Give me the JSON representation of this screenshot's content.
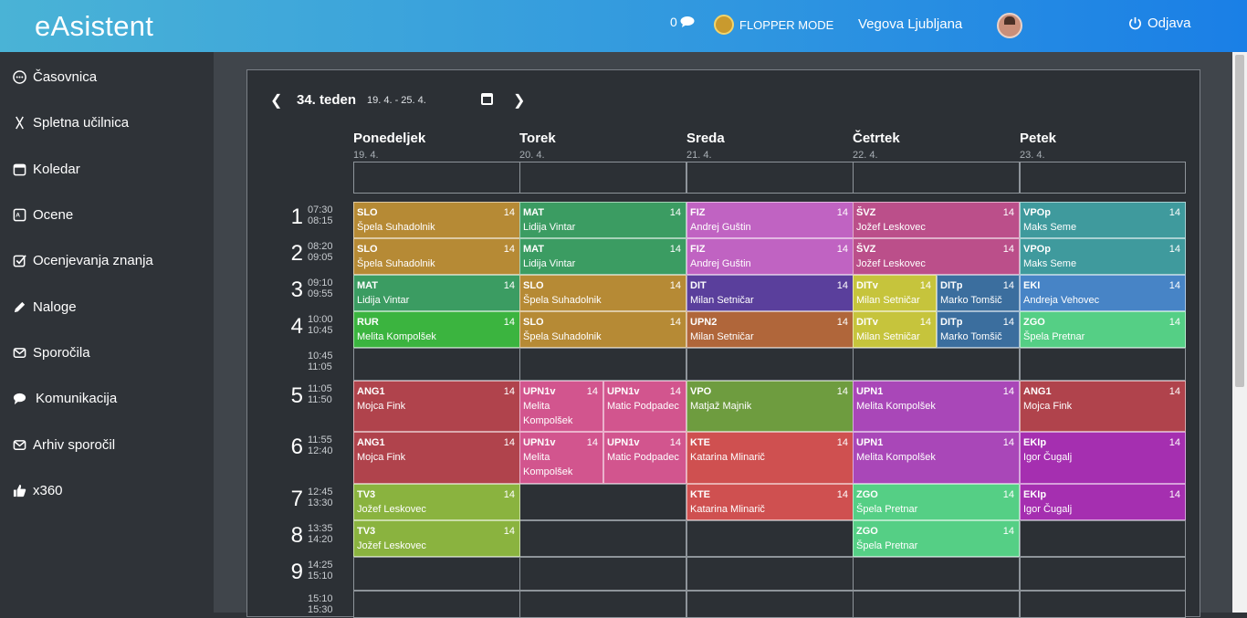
{
  "topbar": {
    "brand": "eAsistent",
    "message_count": "0",
    "flopper": "FLOPPER MODE",
    "school": "Vegova Ljubljana",
    "logout": "Odjava"
  },
  "sidebar": [
    {
      "label": "Časovnica",
      "icon": "timeline-icon"
    },
    {
      "label": "Spletna učilnica",
      "icon": "classroom-icon"
    },
    {
      "label": "Koledar",
      "icon": "calendar-icon"
    },
    {
      "label": "Ocene",
      "icon": "grades-icon"
    },
    {
      "label": "Ocenjevanja znanja",
      "icon": "check-icon"
    },
    {
      "label": "Naloge",
      "icon": "pencil-icon"
    },
    {
      "label": "Sporočila",
      "icon": "envelope-icon"
    },
    {
      "label": "Komunikacija",
      "icon": "chat-icon"
    },
    {
      "label": "Arhiv sporočil",
      "icon": "archive-envelope-icon"
    },
    {
      "label": "x360",
      "icon": "thumbs-up-icon"
    }
  ],
  "week": {
    "title": "34. teden",
    "range": "19. 4. - 25. 4."
  },
  "days": [
    {
      "name": "Ponedeljek",
      "date": "19. 4."
    },
    {
      "name": "Torek",
      "date": "20. 4."
    },
    {
      "name": "Sreda",
      "date": "21. 4."
    },
    {
      "name": "Četrtek",
      "date": "22. 4."
    },
    {
      "name": "Petek",
      "date": "23. 4."
    }
  ],
  "hours": [
    {
      "num": "1",
      "start": "07:30",
      "end": "08:15"
    },
    {
      "num": "2",
      "start": "08:20",
      "end": "09:05"
    },
    {
      "num": "3",
      "start": "09:10",
      "end": "09:55"
    },
    {
      "num": "4",
      "start": "10:00",
      "end": "10:45"
    },
    {
      "num": "",
      "start": "10:45",
      "end": "11:05"
    },
    {
      "num": "5",
      "start": "11:05",
      "end": "11:50"
    },
    {
      "num": "6",
      "start": "11:55",
      "end": "12:40"
    },
    {
      "num": "7",
      "start": "12:45",
      "end": "13:30"
    },
    {
      "num": "8",
      "start": "13:35",
      "end": "14:20"
    },
    {
      "num": "9",
      "start": "14:25",
      "end": "15:10"
    },
    {
      "num": "",
      "start": "15:10",
      "end": "15:30"
    }
  ],
  "lessons": [
    {
      "day": 0,
      "row": 0,
      "half": 0,
      "subj": "SLO",
      "teacher": "Špela Suhadolnik",
      "room": "14",
      "color": "#b68a35"
    },
    {
      "day": 1,
      "row": 0,
      "half": 0,
      "subj": "MAT",
      "teacher": "Lidija Vintar",
      "room": "14",
      "color": "#3b9c62"
    },
    {
      "day": 2,
      "row": 0,
      "half": 0,
      "subj": "FIZ",
      "teacher": "Andrej Guštin",
      "room": "14",
      "color": "#c063c2"
    },
    {
      "day": 3,
      "row": 0,
      "half": 0,
      "subj": "ŠVZ",
      "teacher": "Jožef Leskovec",
      "room": "14",
      "color": "#bb4f8a"
    },
    {
      "day": 4,
      "row": 0,
      "half": 0,
      "subj": "VPOp",
      "teacher": "Maks Seme",
      "room": "14",
      "color": "#3f9a9d"
    },
    {
      "day": 0,
      "row": 1,
      "half": 0,
      "subj": "SLO",
      "teacher": "Špela Suhadolnik",
      "room": "14",
      "color": "#b68a35"
    },
    {
      "day": 1,
      "row": 1,
      "half": 0,
      "subj": "MAT",
      "teacher": "Lidija Vintar",
      "room": "14",
      "color": "#3b9c62"
    },
    {
      "day": 2,
      "row": 1,
      "half": 0,
      "subj": "FIZ",
      "teacher": "Andrej Guštin",
      "room": "14",
      "color": "#c063c2"
    },
    {
      "day": 3,
      "row": 1,
      "half": 0,
      "subj": "ŠVZ",
      "teacher": "Jožef Leskovec",
      "room": "14",
      "color": "#bb4f8a"
    },
    {
      "day": 4,
      "row": 1,
      "half": 0,
      "subj": "VPOp",
      "teacher": "Maks Seme",
      "room": "14",
      "color": "#3f9a9d"
    },
    {
      "day": 0,
      "row": 2,
      "half": 0,
      "subj": "MAT",
      "teacher": "Lidija Vintar",
      "room": "14",
      "color": "#3b9c62"
    },
    {
      "day": 1,
      "row": 2,
      "half": 0,
      "subj": "SLO",
      "teacher": "Špela Suhadolnik",
      "room": "14",
      "color": "#b68a35"
    },
    {
      "day": 2,
      "row": 2,
      "half": 0,
      "subj": "DIT",
      "teacher": "Milan Setničar",
      "room": "14",
      "color": "#5a3f9c"
    },
    {
      "day": 3,
      "row": 2,
      "half": 1,
      "subj": "DITv",
      "teacher": "Milan Setničar",
      "room": "14",
      "color": "#c6c43c"
    },
    {
      "day": 3,
      "row": 2,
      "half": 2,
      "subj": "DITp",
      "teacher": "Marko Tomšič",
      "room": "14",
      "color": "#3b6e9e"
    },
    {
      "day": 4,
      "row": 2,
      "half": 0,
      "subj": "EKI",
      "teacher": "Andreja Vehovec",
      "room": "14",
      "color": "#4784c6"
    },
    {
      "day": 0,
      "row": 3,
      "half": 0,
      "subj": "RUR",
      "teacher": "Melita Kompolšek",
      "room": "14",
      "color": "#3bb43f"
    },
    {
      "day": 1,
      "row": 3,
      "half": 0,
      "subj": "SLO",
      "teacher": "Špela Suhadolnik",
      "room": "14",
      "color": "#b68a35"
    },
    {
      "day": 2,
      "row": 3,
      "half": 0,
      "subj": "UPN2",
      "teacher": "Milan Setničar",
      "room": "14",
      "color": "#b0663a"
    },
    {
      "day": 3,
      "row": 3,
      "half": 1,
      "subj": "DITv",
      "teacher": "Milan Setničar",
      "room": "14",
      "color": "#c6c43c"
    },
    {
      "day": 3,
      "row": 3,
      "half": 2,
      "subj": "DITp",
      "teacher": "Marko Tomšič",
      "room": "14",
      "color": "#3b6e9e"
    },
    {
      "day": 4,
      "row": 3,
      "half": 0,
      "subj": "ZGO",
      "teacher": "Špela Pretnar",
      "room": "14",
      "color": "#55cf85"
    },
    {
      "day": 0,
      "row": 5,
      "half": 0,
      "subj": "ANG1",
      "teacher": "Mojca Fink",
      "room": "14",
      "color": "#b0434c"
    },
    {
      "day": 1,
      "row": 5,
      "half": 1,
      "subj": "UPN1v",
      "teacher": "Melita Kompolšek",
      "room": "14",
      "color": "#d2558e"
    },
    {
      "day": 1,
      "row": 5,
      "half": 2,
      "subj": "UPN1v",
      "teacher": "Matic Podpadec",
      "room": "14",
      "color": "#d2558e"
    },
    {
      "day": 2,
      "row": 5,
      "half": 0,
      "subj": "VPO",
      "teacher": "Matjaž Majnik",
      "room": "14",
      "color": "#6e9c3f"
    },
    {
      "day": 3,
      "row": 5,
      "half": 0,
      "subj": "UPN1",
      "teacher": "Melita Kompolšek",
      "room": "14",
      "color": "#a947b8"
    },
    {
      "day": 4,
      "row": 5,
      "half": 0,
      "subj": "ANG1",
      "teacher": "Mojca Fink",
      "room": "14",
      "color": "#b0434c"
    },
    {
      "day": 0,
      "row": 6,
      "half": 0,
      "subj": "ANG1",
      "teacher": "Mojca Fink",
      "room": "14",
      "color": "#b0434c"
    },
    {
      "day": 1,
      "row": 6,
      "half": 1,
      "subj": "UPN1v",
      "teacher": "Melita Kompolšek",
      "room": "14",
      "color": "#d2558e"
    },
    {
      "day": 1,
      "row": 6,
      "half": 2,
      "subj": "UPN1v",
      "teacher": "Matic Podpadec",
      "room": "14",
      "color": "#d2558e"
    },
    {
      "day": 2,
      "row": 6,
      "half": 0,
      "subj": "KTE",
      "teacher": "Katarina Mlinarič",
      "room": "14",
      "color": "#cf5050"
    },
    {
      "day": 3,
      "row": 6,
      "half": 0,
      "subj": "UPN1",
      "teacher": "Melita Kompolšek",
      "room": "14",
      "color": "#a947b8"
    },
    {
      "day": 4,
      "row": 6,
      "half": 0,
      "subj": "EKIp",
      "teacher": "Igor Čugalj",
      "room": "14",
      "color": "#a52fb0"
    },
    {
      "day": 0,
      "row": 7,
      "half": 0,
      "subj": "TV3",
      "teacher": "Jožef Leskovec",
      "room": "14",
      "color": "#8ab33f"
    },
    {
      "day": 2,
      "row": 7,
      "half": 0,
      "subj": "KTE",
      "teacher": "Katarina Mlinarič",
      "room": "14",
      "color": "#cf5050"
    },
    {
      "day": 3,
      "row": 7,
      "half": 0,
      "subj": "ZGO",
      "teacher": "Špela Pretnar",
      "room": "14",
      "color": "#55cf85"
    },
    {
      "day": 4,
      "row": 7,
      "half": 0,
      "subj": "EKIp",
      "teacher": "Igor Čugalj",
      "room": "14",
      "color": "#a52fb0"
    },
    {
      "day": 0,
      "row": 8,
      "half": 0,
      "subj": "TV3",
      "teacher": "Jožef Leskovec",
      "room": "14",
      "color": "#8ab33f"
    },
    {
      "day": 3,
      "row": 8,
      "half": 0,
      "subj": "ZGO",
      "teacher": "Špela Pretnar",
      "room": "14",
      "color": "#55cf85"
    }
  ]
}
